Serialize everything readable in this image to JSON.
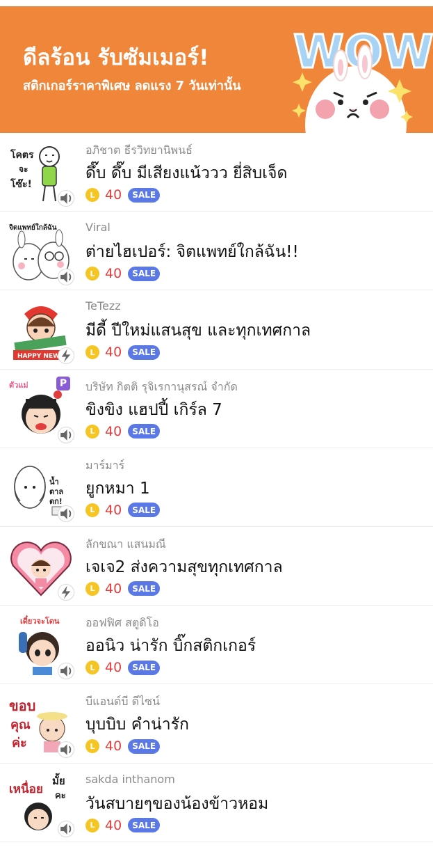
{
  "banner": {
    "title": "ดีลร้อน รับซัมเมอร์!",
    "subtitle": "สติกเกอร์ราคาพิเศษ ลดแรง 7 วันเท่านั้น",
    "art_text": "WOW",
    "bg_color": "#f0863a"
  },
  "list": {
    "coin_letter": "L",
    "sale_color": "#5a79e6",
    "price_color": "#e23c3c",
    "items": [
      {
        "author": "อภิชาต ธีรวิทยานิพนธ์",
        "title": "ดึ๊บ ดึ๊บ มีเสียงแน้ววว ยี่สิบเจ็ด",
        "price": "40",
        "sale": "SALE",
        "thumb_text": "โคตร จะ โซ๊ะ!",
        "icon": "sound-icon"
      },
      {
        "author": "Viral",
        "title": "ต่ายไฮเปอร์: จิตแพทย์ใกล้ฉัน!!",
        "price": "40",
        "sale": "SALE",
        "thumb_text": "จิตแพทย์ใกล้ฉัน",
        "icon": "sound-icon"
      },
      {
        "author": "TeTezz",
        "title": "มีดี้ ปีใหม่แสนสุข และทุกเทศกาล",
        "price": "40",
        "sale": "SALE",
        "thumb_text": "HAPPY NEW",
        "icon": "animation-icon"
      },
      {
        "author": "บริษัท กิตติ รุจิเรกานุสรณ์ จำกัด",
        "title": "ขิงขิง แฮปปี้ เกิร์ล 7",
        "price": "40",
        "sale": "SALE",
        "thumb_text": "ตัวแม่",
        "badge": "P",
        "icon": "sound-icon"
      },
      {
        "author": "มาร์มาร์",
        "title": "ยูกหมา 1",
        "price": "40",
        "sale": "SALE",
        "thumb_text": "น้ำ ตาล ตก!",
        "icon": "sound-icon"
      },
      {
        "author": "ลักขณา แสนมณี",
        "title": "เจเจ2 ส่งความสุขทุกเทศกาล",
        "price": "40",
        "sale": "SALE",
        "thumb_text": "",
        "icon": "animation-icon"
      },
      {
        "author": "ออฟฟิศ สตูดิโอ",
        "title": "ออนิว น่ารัก บิ๊กสติกเกอร์",
        "price": "40",
        "sale": "SALE",
        "thumb_text": "เดี๋ยวจะโดน",
        "icon": "sound-icon"
      },
      {
        "author": "บีแอนด์บี ดีไซน์",
        "title": "บุบบิบ คำน่ารัก",
        "price": "40",
        "sale": "SALE",
        "thumb_text": "ขอบ คุณ ค่ะ",
        "icon": "sound-icon"
      },
      {
        "author": "sakda inthanom",
        "title": "วันสบายๆของน้องข้าวหอม",
        "price": "40",
        "sale": "SALE",
        "thumb_text": "เหนื่อย มั้ย คะ",
        "icon": "sound-icon"
      }
    ]
  }
}
